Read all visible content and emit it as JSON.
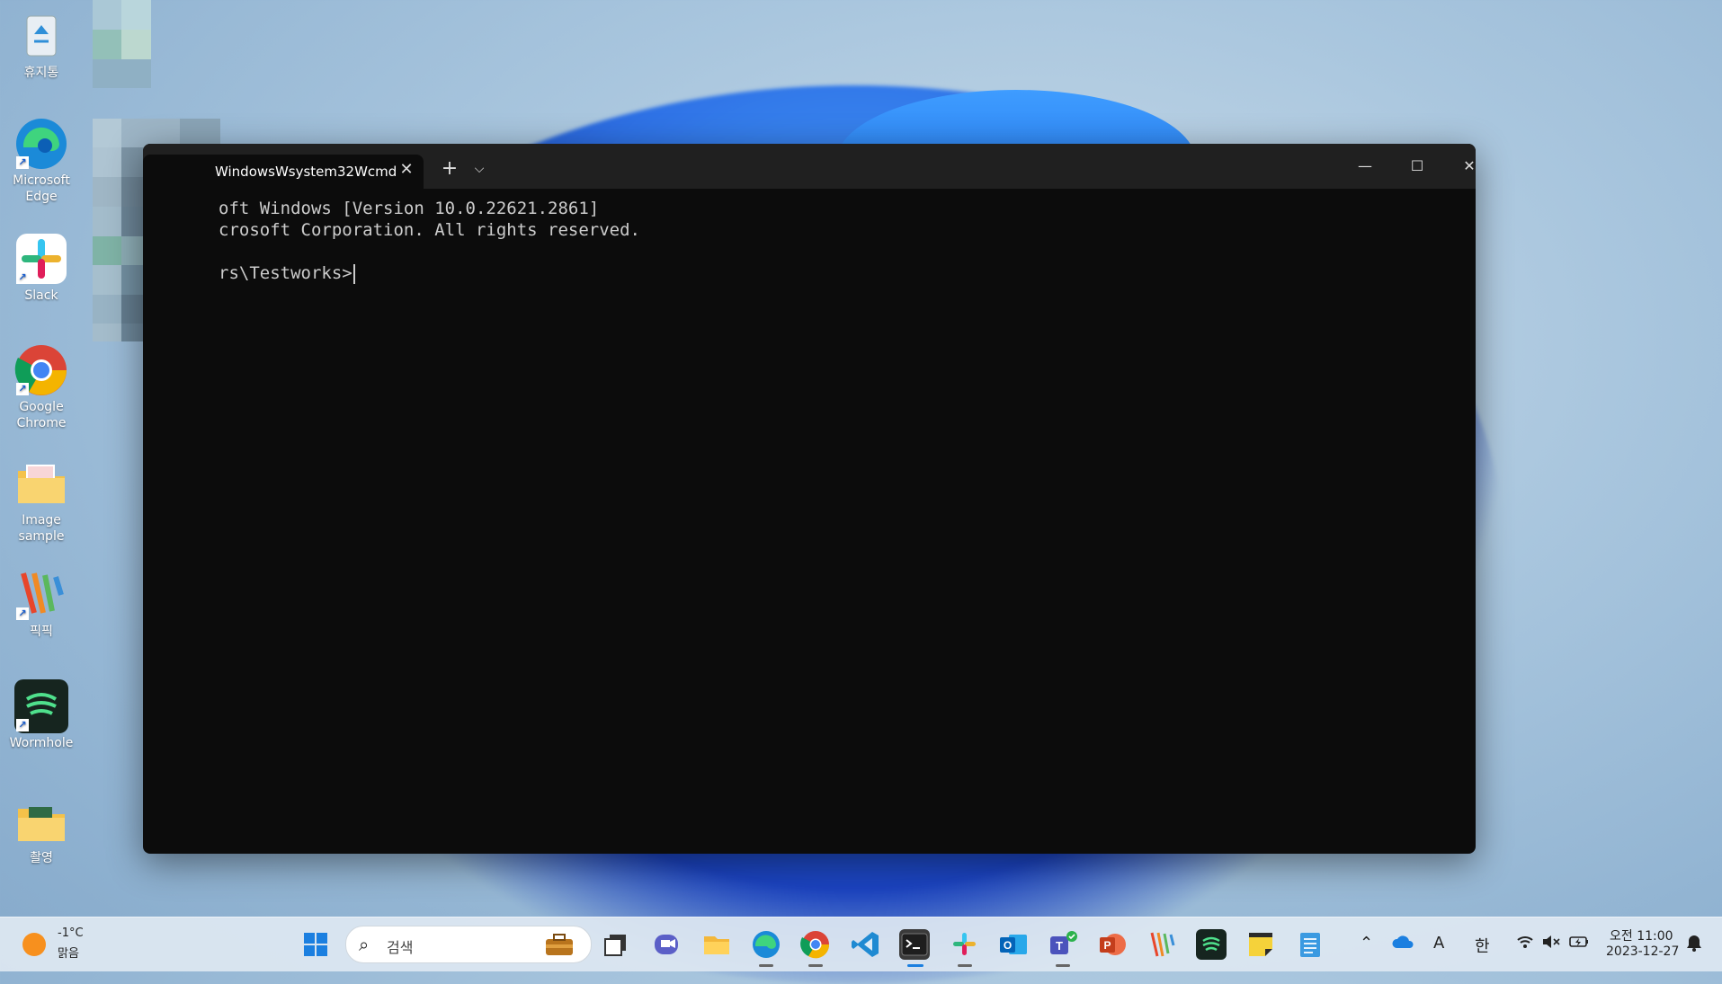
{
  "desktop": {
    "icons": [
      {
        "label": "휴지통",
        "icon": "recycle-bin-icon"
      },
      {
        "label": "Microsoft Edge",
        "icon": "edge-icon"
      },
      {
        "label": "Slack",
        "icon": "slack-icon"
      },
      {
        "label": "Google Chrome",
        "icon": "chrome-icon"
      },
      {
        "label": "Image sample",
        "icon": "folder-icon"
      },
      {
        "label": "픽픽",
        "icon": "picpick-icon"
      },
      {
        "label": "Wormhole",
        "icon": "wormhole-icon"
      },
      {
        "label": "촬영",
        "icon": "folder-icon"
      }
    ]
  },
  "terminal": {
    "tab_title": "WindowsWsystem32Wcmd",
    "lines": [
      "oft Windows [Version 10.0.22621.2861]",
      "crosoft Corporation. All rights reserved.",
      "",
      "rs\\Testworks>"
    ],
    "colors": {
      "background": "#0c0c0c",
      "titlebar": "#202020",
      "text": "#cccccc"
    }
  },
  "taskbar": {
    "weather": {
      "temp": "-1°C",
      "desc": "맑음"
    },
    "search_label": "검색",
    "apps": [
      "start-icon",
      "search",
      "work-icon",
      "task-view-icon",
      "teams-chat-icon",
      "file-explorer-icon",
      "edge-icon",
      "chrome-icon",
      "vscode-icon",
      "terminal-icon",
      "slack-icon",
      "outlook-icon",
      "teams-icon",
      "powerpoint-icon",
      "picpick-icon",
      "wormhole-icon",
      "sticky-notes-icon",
      "notepad-icon"
    ],
    "tray": {
      "ime_letter": "A",
      "ime_lang": "한"
    },
    "clock": {
      "time": "오전 11:00",
      "date": "2023-12-27"
    }
  }
}
